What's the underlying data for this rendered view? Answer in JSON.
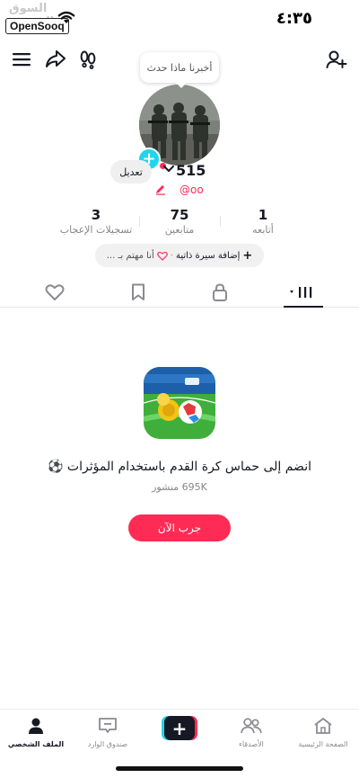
{
  "status_bar": {
    "watermark_text": "السوق المفتوح",
    "watermark_badge": "OpenSooq",
    "time": "٤:٣٥"
  },
  "topnav": {
    "icons": [
      "menu-icon",
      "share-icon",
      "footprints-icon",
      "add-friend-icon"
    ]
  },
  "profile": {
    "bubble_text": "أخبرنا ماذا حدث",
    "edit_label": "تعديل",
    "username": "515",
    "handle": "@oo",
    "stats": [
      {
        "value": "1",
        "label": "أتابعه"
      },
      {
        "value": "75",
        "label": "متابعين"
      },
      {
        "value": "3",
        "label": "تسجيلات الإعجاب"
      }
    ],
    "bio_add": "إضافة سيرة ذاتية",
    "bio_interest": "أنا مهتم بـ ..."
  },
  "tabs": [
    "videos-grid-icon",
    "lock-icon",
    "bookmark-icon",
    "heart-icon"
  ],
  "promo": {
    "title": "انضم إلى حماس كرة القدم باستخدام المؤثرات ⚽",
    "subtitle": "695K منشور",
    "button": "جرب الآن"
  },
  "bottom_nav": {
    "home": "الصفحة الرئيسية",
    "friends": "الأصدقاء",
    "inbox": "صندوق الوارد",
    "profile": "الملف الشخصي"
  },
  "colors": {
    "accent": "#fe2c55",
    "cyan": "#20d5ec",
    "text": "#161823",
    "muted": "#86878b"
  }
}
